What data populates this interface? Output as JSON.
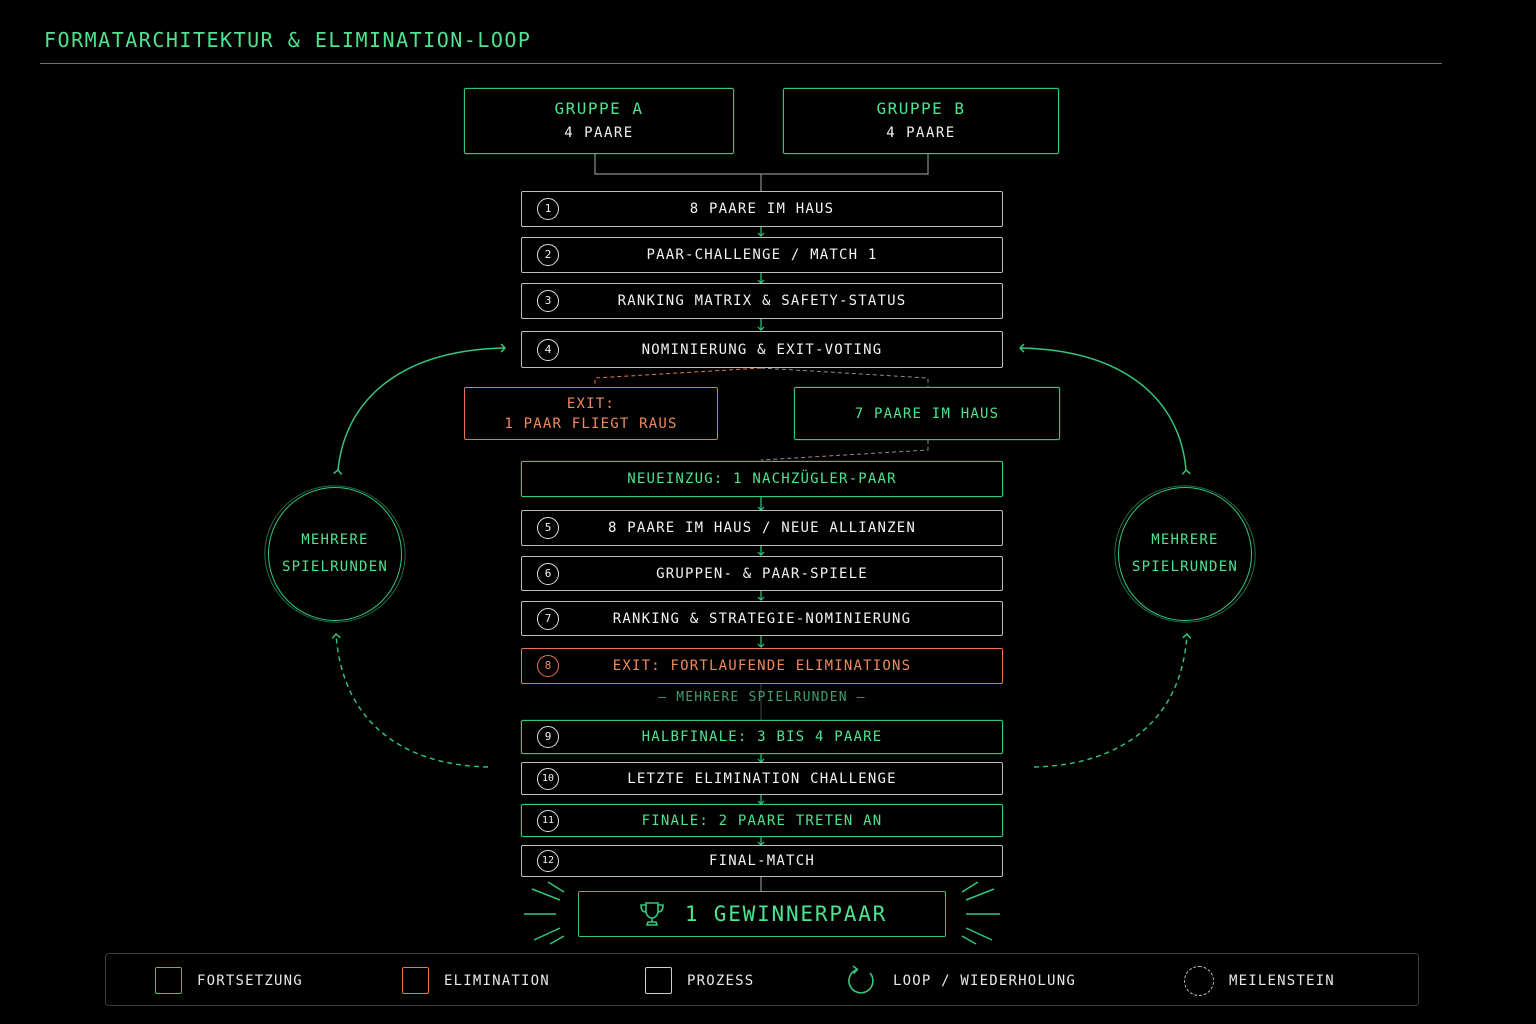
{
  "title": "FORMATARCHITEKTUR & ELIMINATION-LOOP",
  "groups": {
    "a": {
      "title": "GRUPPE A",
      "sub": "4 PAARE"
    },
    "b": {
      "title": "GRUPPE B",
      "sub": "4 PAARE"
    }
  },
  "steps": [
    {
      "num": "1",
      "label": "8 PAARE IM HAUS"
    },
    {
      "num": "2",
      "label": "PAAR-CHALLENGE / MATCH 1"
    },
    {
      "num": "3",
      "label": "RANKING MATRIX & SAFETY-STATUS"
    },
    {
      "num": "4",
      "label": "NOMINIERUNG & EXIT-VOTING"
    },
    {
      "num": "5",
      "label": "8 PAARE IM HAUS / NEUE ALLIANZEN"
    },
    {
      "num": "6",
      "label": "GRUPPEN- & PAAR-SPIELE"
    },
    {
      "num": "7",
      "label": "RANKING & STRATEGIE-NOMINIERUNG"
    },
    {
      "num": "8",
      "label": "EXIT: FORTLAUFENDE ELIMINATIONS"
    },
    {
      "num": "9",
      "label": "HALBFINALE: 3 BIS 4 PAARE"
    },
    {
      "num": "10",
      "label": "LETZTE ELIMINATION CHALLENGE"
    },
    {
      "num": "11",
      "label": "FINALE: 2 PAARE TRETEN AN"
    },
    {
      "num": "12",
      "label": "FINAL-MATCH"
    }
  ],
  "exit_box": {
    "line1": "EXIT:",
    "line2": "1 PAAR FLIEGT RAUS"
  },
  "remain_box": "7 PAARE IM HAUS",
  "neueinzug": "NEUEINZUG: 1 NACHZÜGLER-PAAR",
  "loop_circle": {
    "line1": "MEHRERE",
    "line2": "SPIELRUNDEN"
  },
  "divider": "— MEHRERE SPIELRUNDEN —",
  "winner": "1 GEWINNERPAAR",
  "legend": {
    "fortsetzung": "FORTSETZUNG",
    "elimination": "ELIMINATION",
    "prozess": "PROZESS",
    "loop": "LOOP / WIEDERHOLUNG",
    "meilenstein": "MEILENSTEIN"
  },
  "colors": {
    "green": "#34c77a",
    "orange": "#e5774f",
    "white": "#bdbdbd",
    "background": "#000000"
  }
}
